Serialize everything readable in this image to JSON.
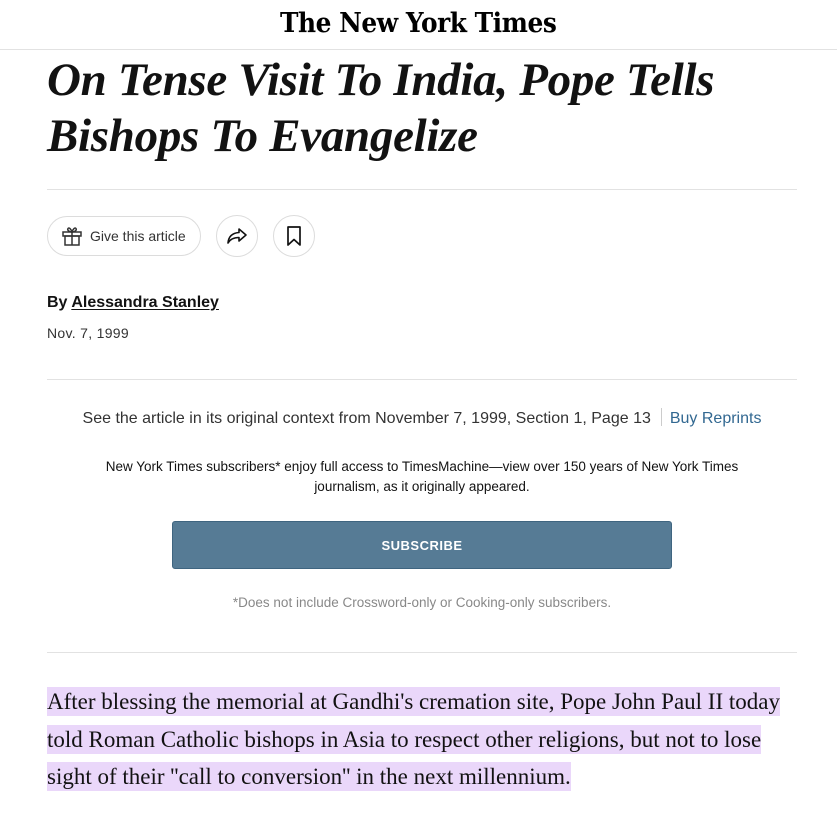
{
  "masthead": {
    "logo_text": "The New York Times"
  },
  "article": {
    "headline": "On Tense Visit To India, Pope Tells Bishops To Evangelize",
    "actions": {
      "give_label": "Give this article",
      "share_icon": "share-arrow-icon",
      "save_icon": "bookmark-icon",
      "gift_icon": "gift-icon"
    },
    "byline": {
      "prefix": "By",
      "author": "Alessandra Stanley"
    },
    "date": "Nov. 7, 1999",
    "context": {
      "text": "See the article in its original context from November 7, 1999, Section 1, Page 13",
      "reprints_label": "Buy Reprints"
    },
    "promo": {
      "text": "New York Times subscribers* enjoy full access to TimesMachine—view over 150 years of New York Times journalism, as it originally appeared.",
      "subscribe_label": "SUBSCRIBE",
      "disclaimer": "*Does not include Crossword-only or Cooking-only subscribers."
    },
    "body_paragraph": "After blessing the memorial at Gandhi's cremation site, Pope John Paul II today told Roman Catholic bishops in Asia to respect other religions, but not to lose sight of their ''call to conversion'' in the next millennium."
  },
  "colors": {
    "subscribe_button": "#567b95",
    "link": "#326891",
    "highlight": "#ead7fa"
  }
}
